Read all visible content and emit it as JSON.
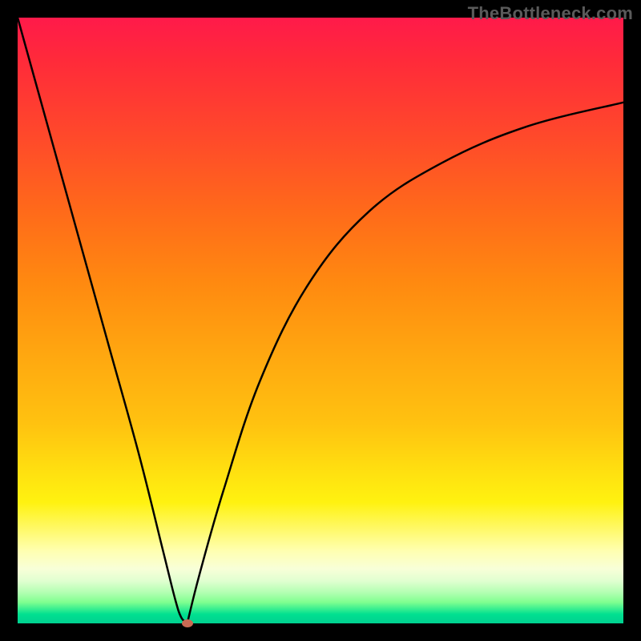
{
  "watermark": "TheBottleneck.com",
  "chart_data": {
    "type": "line",
    "title": "",
    "xlabel": "",
    "ylabel": "",
    "xlim": [
      0,
      100
    ],
    "ylim": [
      0,
      100
    ],
    "series": [
      {
        "name": "left-branch",
        "x": [
          0,
          5,
          10,
          15,
          20,
          24,
          26,
          27,
          28
        ],
        "values": [
          100,
          82,
          64,
          46,
          28,
          12,
          4,
          1,
          0
        ]
      },
      {
        "name": "right-branch",
        "x": [
          28,
          30,
          34,
          40,
          48,
          58,
          70,
          84,
          100
        ],
        "values": [
          0,
          8,
          22,
          40,
          56,
          68,
          76,
          82,
          86
        ]
      }
    ],
    "marker": {
      "x": 28,
      "y": 0,
      "color": "#c96a54"
    },
    "gradient_stops": [
      {
        "pos": 0,
        "color": "#ff1a4a"
      },
      {
        "pos": 50,
        "color": "#ff9a10"
      },
      {
        "pos": 80,
        "color": "#fff210"
      },
      {
        "pos": 100,
        "color": "#00d090"
      }
    ]
  }
}
